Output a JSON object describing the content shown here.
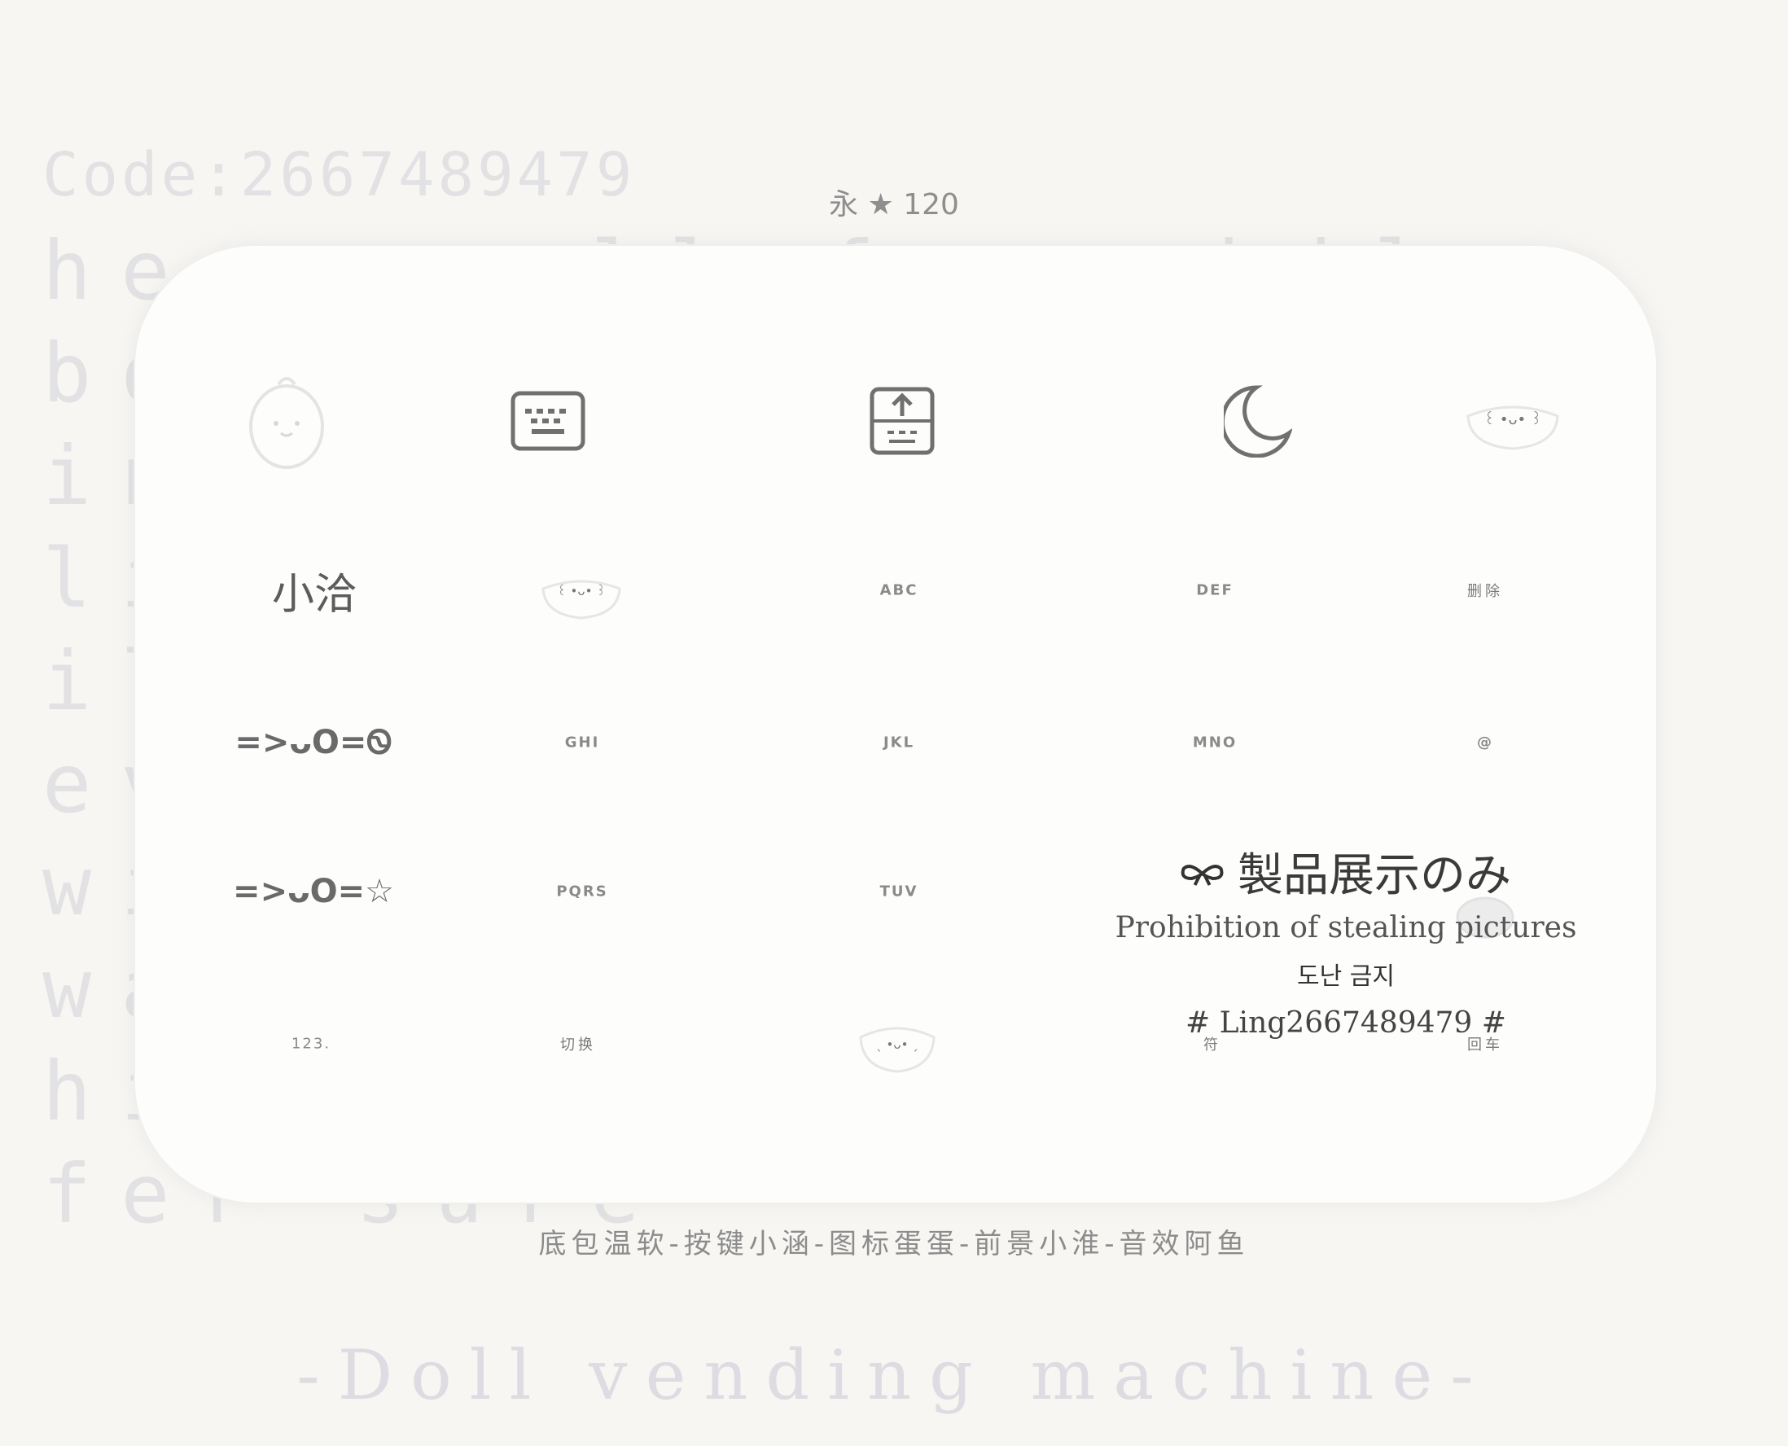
{
  "background": {
    "code_line": "Code:2667489479",
    "lines": [
      "her small fac while",
      "bo",
      "in",
      "li",
      "il",
      "ev",
      "wi",
      "wa",
      "hi",
      "fer sure"
    ]
  },
  "badge": "永 ★ 120",
  "keyboard": {
    "row1": {
      "keyboard_icon": "keyboard-icon",
      "upload_icon": "keyboard-upload-icon",
      "moon_icon": "moon-icon",
      "mascot_icon": "mascot-egg-icon",
      "face_icon": "cute-face-icon"
    },
    "row2": {
      "k1": "小洽",
      "k3": "ABC",
      "k4": "DEF",
      "k5": "删除"
    },
    "row3": {
      "k1": "=>ᴗO=Ꮻ",
      "k2": "GHI",
      "k3": "JKL",
      "k4": "MNO",
      "k5": "@"
    },
    "row4": {
      "k1": "=>ᴗO=☆",
      "k2": "PQRS",
      "k3": "TUV"
    },
    "row5": {
      "k1": "123.",
      "k2": "切换",
      "k4": "符",
      "k5": "回车"
    }
  },
  "watermark": {
    "jp": "製品展示のみ",
    "en": "Prohibition of stealing pictures",
    "ko": "도난 금지",
    "id": "# Ling2667489479 #"
  },
  "credits": "底包温软-按键小涵-图标蛋蛋-前景小淮-音效阿鱼",
  "bottom_title": "-Doll vending machine-",
  "colors": {
    "background": "#f7f6f3",
    "panel": "#fdfdfc",
    "text": "#666666"
  }
}
